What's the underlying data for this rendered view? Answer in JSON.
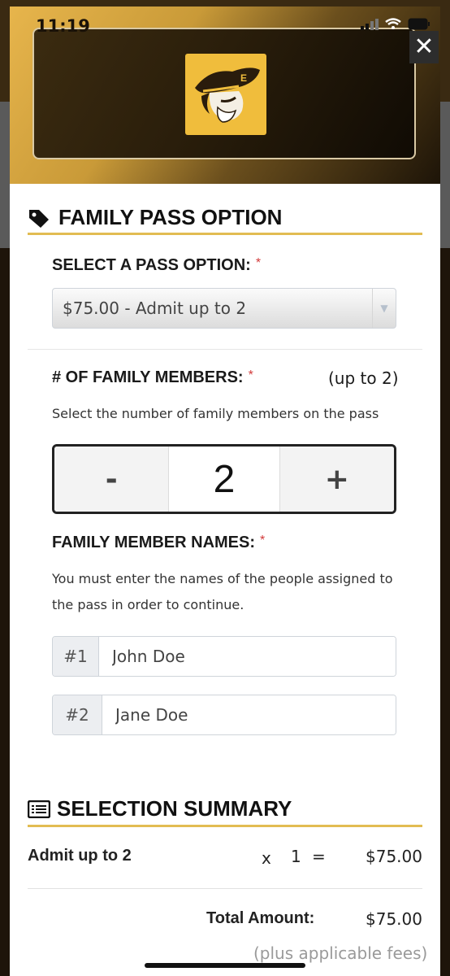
{
  "status_bar": {
    "time": "11:19"
  },
  "header": {
    "close_icon": "close-icon",
    "logo": "pirate-logo"
  },
  "family_pass": {
    "title": "FAMILY PASS OPTION",
    "icon": "tags-icon",
    "select_label": "SELECT A PASS OPTION:",
    "required_mark": "*",
    "selected_option": "$75.00 - Admit up to 2",
    "members_label": "# OF FAMILY MEMBERS:",
    "members_limit": "(up to 2)",
    "members_helper": "Select the number of family members on the pass",
    "stepper": {
      "minus": "-",
      "value": "2",
      "plus": "+"
    },
    "names_label": "FAMILY MEMBER NAMES:",
    "names_helper_line1": "You must enter the names of the people assigned to",
    "names_helper_line2": "the pass in order to continue.",
    "names": [
      {
        "prefix": "#1",
        "value": "John Doe"
      },
      {
        "prefix": "#2",
        "value": "Jane Doe"
      }
    ]
  },
  "summary": {
    "title": "SELECTION SUMMARY",
    "icon": "list-icon",
    "item_name": "Admit up to 2",
    "times": "x",
    "qty": "1",
    "equals": "=",
    "item_total": "$75.00",
    "total_label": "Total Amount:",
    "total_value": "$75.00",
    "fees_note": "(plus applicable fees)"
  },
  "colors": {
    "accent": "#e2bc52",
    "required": "#d23a3a"
  }
}
